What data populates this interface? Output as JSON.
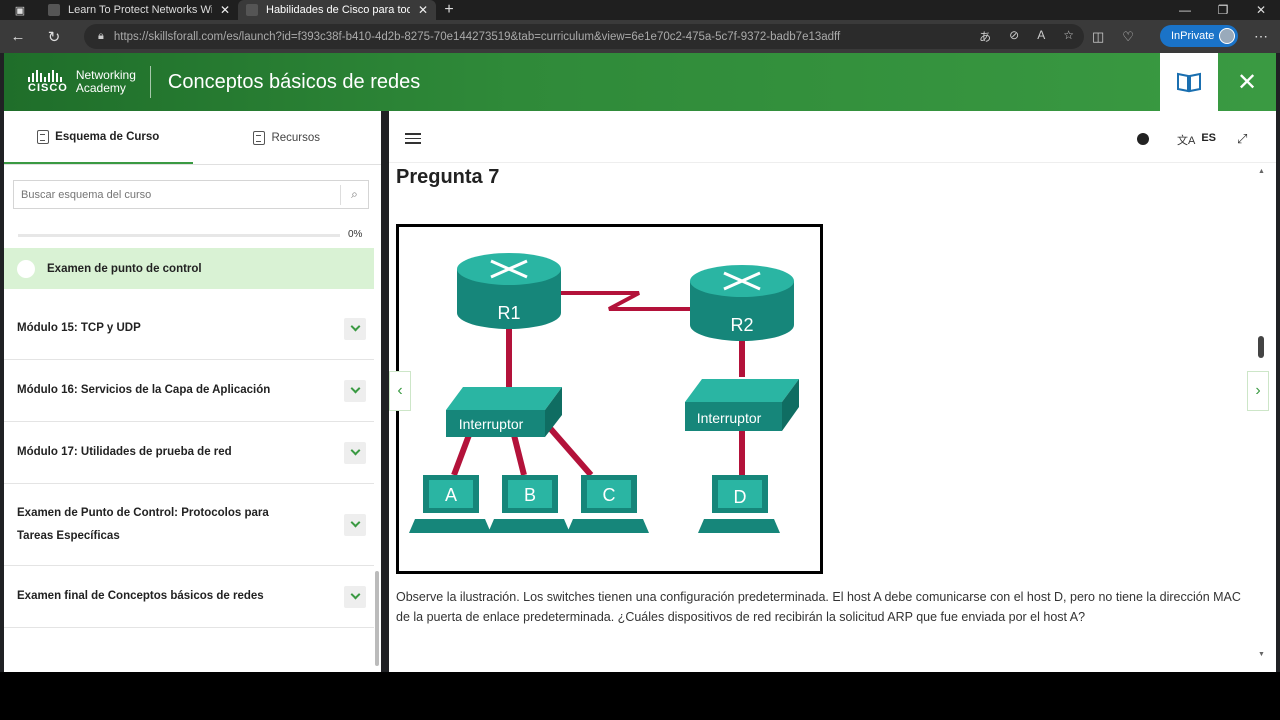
{
  "browser": {
    "tabs": [
      {
        "title": "Learn To Protect Networks With I",
        "active": false
      },
      {
        "title": "Habilidades de Cisco para todos",
        "active": true
      }
    ],
    "url": "https://skillsforall.com/es/launch?id=f393c38f-b410-4d2b-8275-70e144273519&tab=curriculum&view=6e1e70c2-475a-5c7f-9372-badb7e13adff",
    "inprivate_label": "InPrivate"
  },
  "header": {
    "logo_brand": "CISCO",
    "logo_line1": "Networking",
    "logo_line2": "Academy",
    "course_title": "Conceptos básicos de redes"
  },
  "sidebar": {
    "tabs": [
      {
        "label": "Esquema de Curso",
        "active": true
      },
      {
        "label": "Recursos",
        "active": false
      }
    ],
    "search_placeholder": "Buscar esquema del curso",
    "progress_percent": 0,
    "progress_label": "0%",
    "current_item": "Examen de punto de control",
    "modules": [
      {
        "label": "Módulo 15: TCP y UDP"
      },
      {
        "label": "Módulo 16: Servicios de la Capa de Aplicación"
      },
      {
        "label": "Módulo 17: Utilidades de prueba de red"
      },
      {
        "label": "Examen de Punto de Control: Protocolos para Tareas Específicas"
      },
      {
        "label": "Examen final de Conceptos básicos de redes"
      }
    ]
  },
  "main": {
    "language": "ES",
    "question_title": "Pregunta 7",
    "figure": {
      "router1": "R1",
      "router2": "R2",
      "switch_label": "Interruptor",
      "hosts": [
        "A",
        "B",
        "C",
        "D"
      ]
    },
    "question_text": "Observe la ilustración. Los switches tienen una configuración predeterminada. El host A debe comunicarse con el host D, pero no tiene la dirección MAC de la puerta de enlace predeterminada. ¿Cuáles dispositivos de red recibirán la solicitud ARP que fue enviada por el host A?"
  },
  "colors": {
    "brand_green": "#3a9a42",
    "header_dark_green": "#1f6e2a",
    "highlight_green": "#d9f2d4",
    "inprivate_blue": "#1a73c8",
    "device_teal": "#1e9a8a",
    "link_crimson": "#b3123a"
  }
}
